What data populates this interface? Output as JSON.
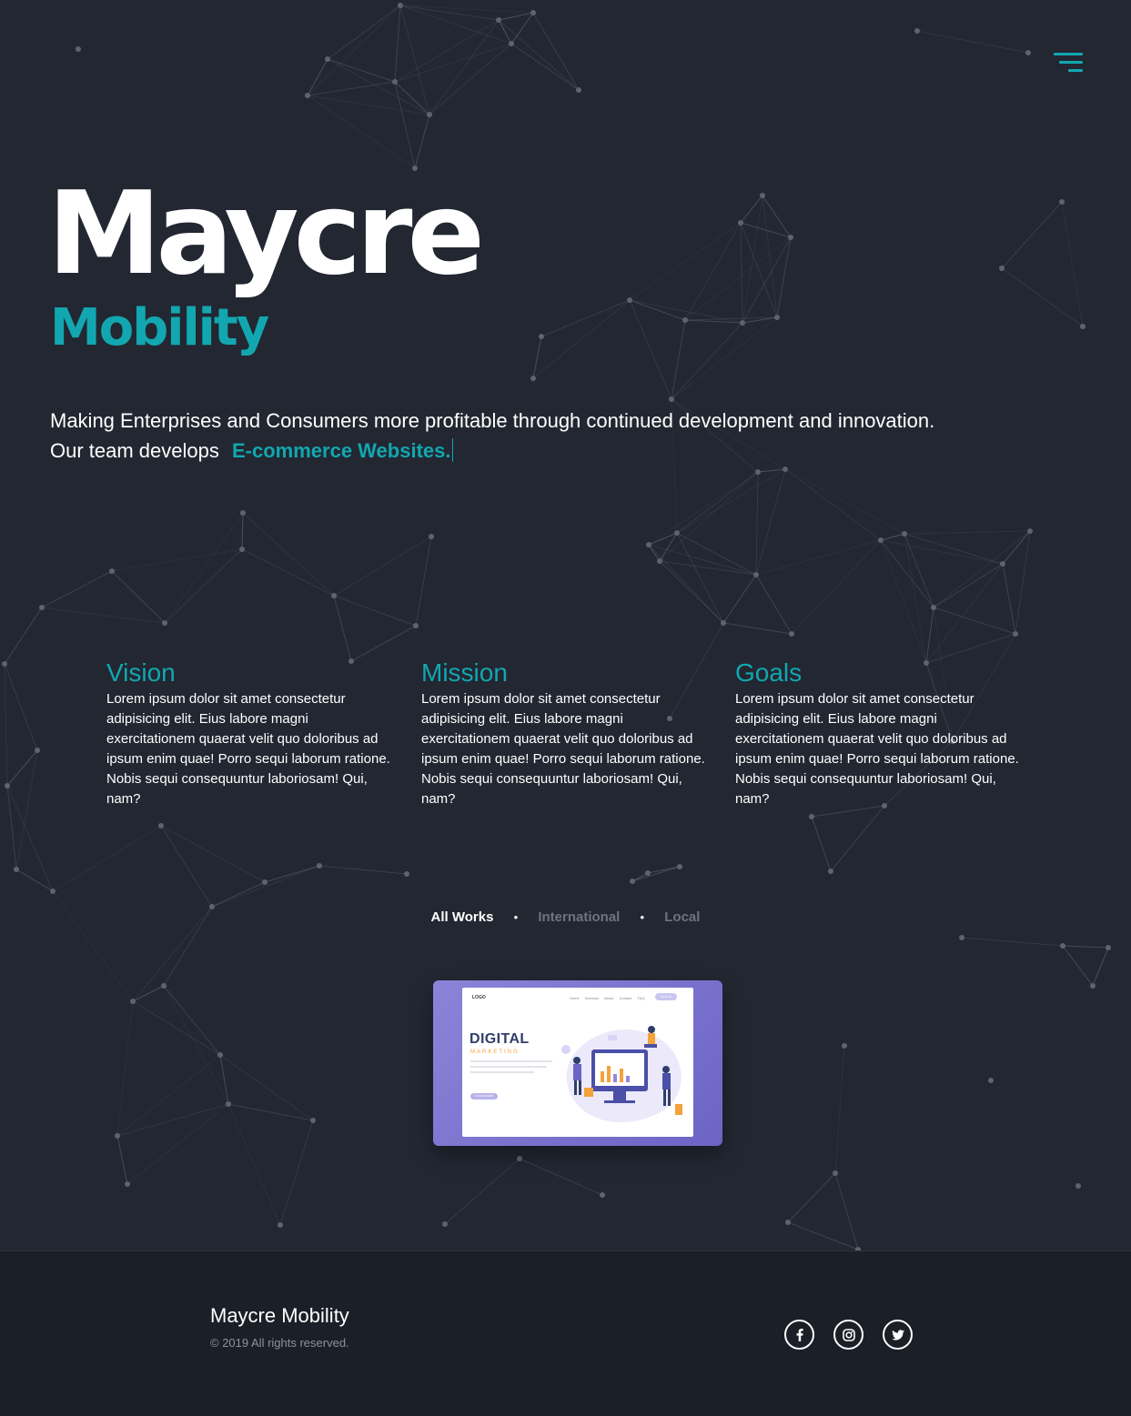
{
  "nav": {
    "menu_icon": "menu-icon"
  },
  "hero": {
    "title": "Maycre",
    "subtitle": "Mobility",
    "tagline_line1": "Making Enterprises and Consumers more profitable through continued development and innovation.",
    "tagline_prefix": "Our team develops",
    "tagline_highlight": "E-commerce Websites."
  },
  "pillars": [
    {
      "title": "Vision",
      "text": "Lorem ipsum dolor sit amet consectetur adipisicing elit. Eius labore magni exercitationem quaerat velit quo doloribus ad ipsum enim quae! Porro sequi laborum ratione. Nobis sequi consequuntur laboriosam! Qui, nam?"
    },
    {
      "title": "Mission",
      "text": "Lorem ipsum dolor sit amet consectetur adipisicing elit. Eius labore magni exercitationem quaerat velit quo doloribus ad ipsum enim quae! Porro sequi laborum ratione. Nobis sequi consequuntur laboriosam! Qui, nam?"
    },
    {
      "title": "Goals",
      "text": "Lorem ipsum dolor sit amet consectetur adipisicing elit. Eius labore magni exercitationem quaerat velit quo doloribus ad ipsum enim quae! Porro sequi laborum ratione. Nobis sequi consequuntur laboriosam! Qui, nam?"
    }
  ],
  "filters": {
    "items": [
      "All Works",
      "International",
      "Local"
    ],
    "active": "All Works"
  },
  "work": {
    "mock_logo": "LOGO",
    "mock_nav": "Home Services About Contact FAQ",
    "mock_signup": "SIGN UP",
    "mock_heading": "DIGITAL",
    "mock_subheading": "MARKETING",
    "mock_button": "LEARN MORE"
  },
  "footer": {
    "brand": "Maycre Mobility",
    "copyright": "© 2019 All rights reserved.",
    "social": [
      {
        "name": "facebook-icon"
      },
      {
        "name": "instagram-icon"
      },
      {
        "name": "twitter-icon"
      }
    ]
  },
  "colors": {
    "background": "#222732",
    "footer_background": "#1b1f27",
    "accent": "#12a7b0",
    "text": "#ffffff",
    "muted": "#6d7380"
  }
}
